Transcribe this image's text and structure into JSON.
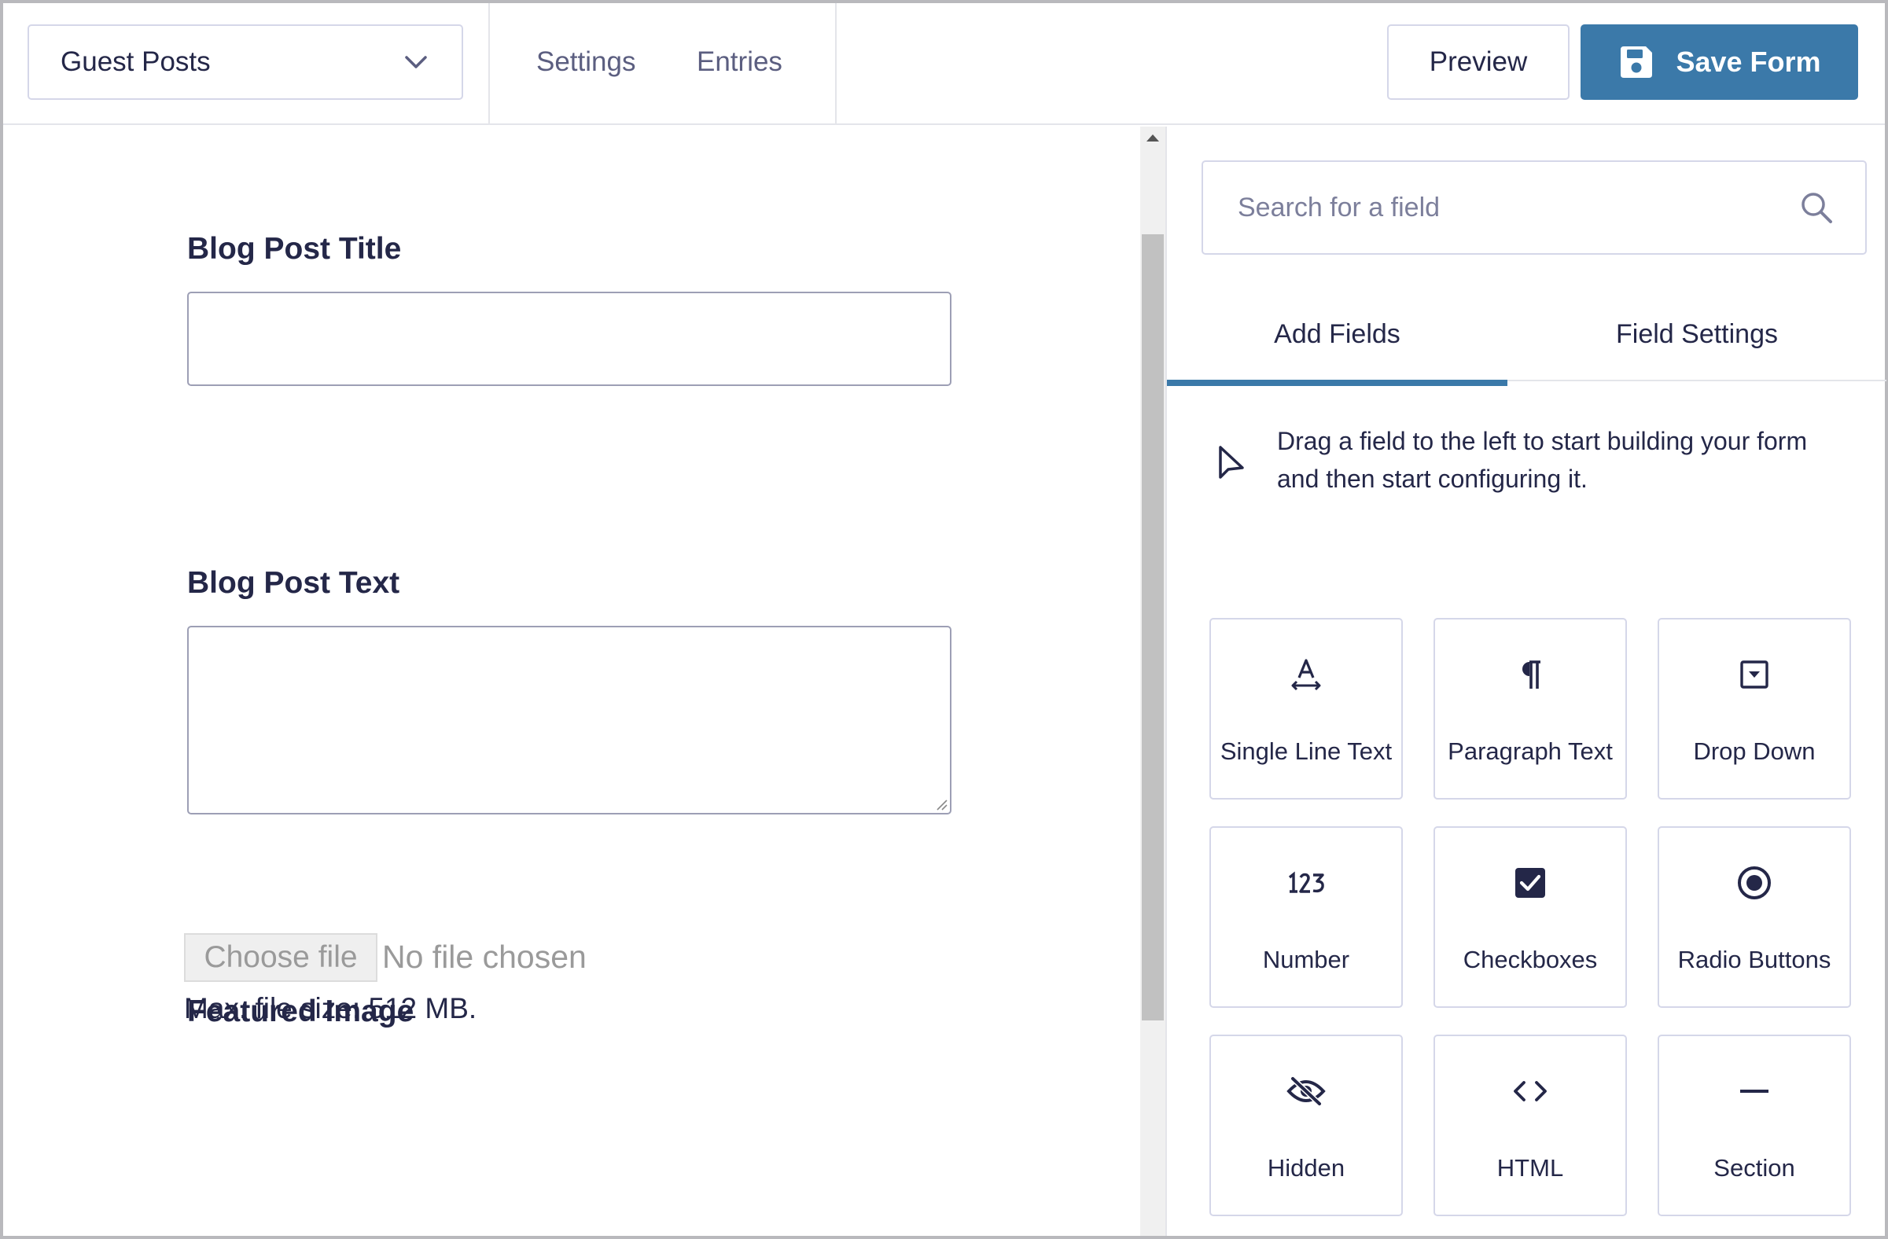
{
  "header": {
    "form_selector": {
      "value": "Guest Posts",
      "icon": "chevron-down-icon"
    },
    "nav": [
      {
        "label": "Settings"
      },
      {
        "label": "Entries"
      }
    ],
    "preview_label": "Preview",
    "save_label": "Save Form",
    "save_icon": "floppy-disk-icon"
  },
  "form": {
    "fields": [
      {
        "label": "Blog Post Title",
        "type": "text",
        "value": ""
      },
      {
        "label": "Blog Post Text",
        "type": "textarea",
        "value": ""
      },
      {
        "label": "Featured Image",
        "type": "file"
      }
    ],
    "file_upload": {
      "button_label": "Choose file",
      "status": "No file chosen",
      "max_size_text": "Max. file size: 512 MB."
    }
  },
  "sidebar": {
    "search": {
      "placeholder": "Search for a field",
      "value": "",
      "icon": "search-icon"
    },
    "tabs": [
      {
        "label": "Add Fields",
        "active": true
      },
      {
        "label": "Field Settings",
        "active": false
      }
    ],
    "hint": "Drag a field to the left to start building your form and then start configuring it.",
    "hint_icon": "cursor-pointer-icon",
    "field_types": [
      {
        "label": "Single Line Text",
        "icon": "single-line-text-icon"
      },
      {
        "label": "Paragraph Text",
        "icon": "paragraph-icon"
      },
      {
        "label": "Drop Down",
        "icon": "dropdown-icon"
      },
      {
        "label": "Number",
        "icon": "number-123-icon"
      },
      {
        "label": "Checkboxes",
        "icon": "checkbox-icon"
      },
      {
        "label": "Radio Buttons",
        "icon": "radio-button-icon"
      },
      {
        "label": "Hidden",
        "icon": "eye-slash-icon"
      },
      {
        "label": "HTML",
        "icon": "code-icon"
      },
      {
        "label": "Section",
        "icon": "section-divider-icon"
      }
    ]
  },
  "colors": {
    "primary": "#3b79a9",
    "text": "#242748",
    "muted_text": "#5b5e80",
    "border": "#d5d7e9",
    "input_border": "#9d9fb5"
  }
}
